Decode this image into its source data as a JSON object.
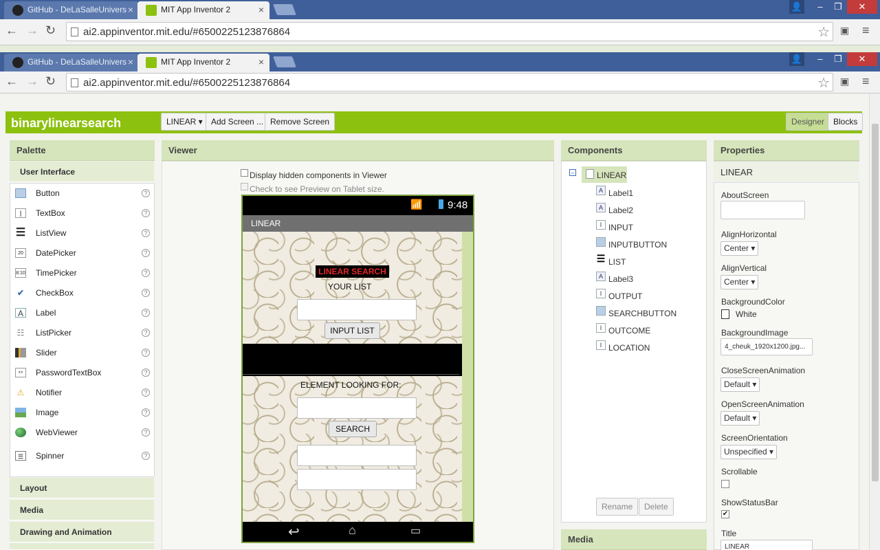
{
  "browser_back": {
    "tabs": [
      {
        "label": "GitHub - DeLaSalleUnivers"
      },
      {
        "label": "MIT App Inventor 2"
      }
    ],
    "url": "ai2.appinventor.mit.edu/#6500225123876864"
  },
  "browser_front": {
    "tabs": [
      {
        "label": "GitHub - DeLaSalleUnivers"
      },
      {
        "label": "MIT App Inventor 2"
      }
    ],
    "url": "ai2.appinventor.mit.edu/#6500225123876864"
  },
  "app": {
    "project_name": "binarylinearsearch",
    "screen_select": "LINEAR ▾",
    "add_screen": "Add Screen ...",
    "remove_screen": "Remove Screen",
    "designer": "Designer",
    "blocks": "Blocks"
  },
  "palette": {
    "title": "Palette",
    "section": "User Interface",
    "items": [
      {
        "label": "Button",
        "icon": "button-icon"
      },
      {
        "label": "TextBox",
        "icon": "textbox-icon"
      },
      {
        "label": "ListView",
        "icon": "listview-icon"
      },
      {
        "label": "DatePicker",
        "icon": "datepicker-icon"
      },
      {
        "label": "TimePicker",
        "icon": "timepicker-icon"
      },
      {
        "label": "CheckBox",
        "icon": "checkbox-icon"
      },
      {
        "label": "Label",
        "icon": "label-icon"
      },
      {
        "label": "ListPicker",
        "icon": "listpicker-icon"
      },
      {
        "label": "Slider",
        "icon": "slider-icon"
      },
      {
        "label": "PasswordTextBox",
        "icon": "passwordtextbox-icon"
      },
      {
        "label": "Notifier",
        "icon": "notifier-icon"
      },
      {
        "label": "Image",
        "icon": "image-icon"
      },
      {
        "label": "WebViewer",
        "icon": "webviewer-icon"
      },
      {
        "label": "Spinner",
        "icon": "spinner-icon"
      }
    ],
    "help": "?",
    "sections": [
      "Layout",
      "Media",
      "Drawing and Animation"
    ]
  },
  "viewer": {
    "title": "Viewer",
    "hidden_label": "Display hidden components in Viewer",
    "tablet_label": "Check to see Preview on Tablet size.",
    "phone": {
      "time": "9:48",
      "screen_title": "LINEAR",
      "heading": "LINEAR SEARCH",
      "your_list": "YOUR LIST",
      "input_button": "INPUT LIST",
      "element_label": "ELEMENT LOOKING FOR:",
      "search_button": "SEARCH"
    }
  },
  "components": {
    "title": "Components",
    "root": "LINEAR",
    "items": [
      {
        "label": "Label1",
        "icon": "A"
      },
      {
        "label": "Label2",
        "icon": "A"
      },
      {
        "label": "INPUT",
        "icon": "I"
      },
      {
        "label": "INPUTBUTTON",
        "icon": "B"
      },
      {
        "label": "LIST",
        "icon": "≡"
      },
      {
        "label": "Label3",
        "icon": "A"
      },
      {
        "label": "OUTPUT",
        "icon": "I"
      },
      {
        "label": "SEARCHBUTTON",
        "icon": "B"
      },
      {
        "label": "OUTCOME",
        "icon": "I"
      },
      {
        "label": "LOCATION",
        "icon": "I"
      }
    ],
    "rename": "Rename",
    "delete": "Delete",
    "media_title": "Media"
  },
  "properties": {
    "title": "Properties",
    "screen": "LINEAR",
    "about_label": "AboutScreen",
    "align_h_label": "AlignHorizontal",
    "align_h_value": "Center ▾",
    "align_v_label": "AlignVertical",
    "align_v_value": "Center ▾",
    "bg_color_label": "BackgroundColor",
    "bg_color_value": "White",
    "bg_image_label": "BackgroundImage",
    "bg_image_value": "4_cheuk_1920x1200.jpg...",
    "close_anim_label": "CloseScreenAnimation",
    "close_anim_value": "Default ▾",
    "open_anim_label": "OpenScreenAnimation",
    "open_anim_value": "Default ▾",
    "orientation_label": "ScreenOrientation",
    "orientation_value": "Unspecified ▾",
    "scrollable_label": "Scrollable",
    "status_bar_label": "ShowStatusBar",
    "title_label": "Title",
    "title_value": "LINEAR"
  },
  "colors": {
    "accent": "#8dc10f",
    "chrome": "#3f5f9b"
  }
}
